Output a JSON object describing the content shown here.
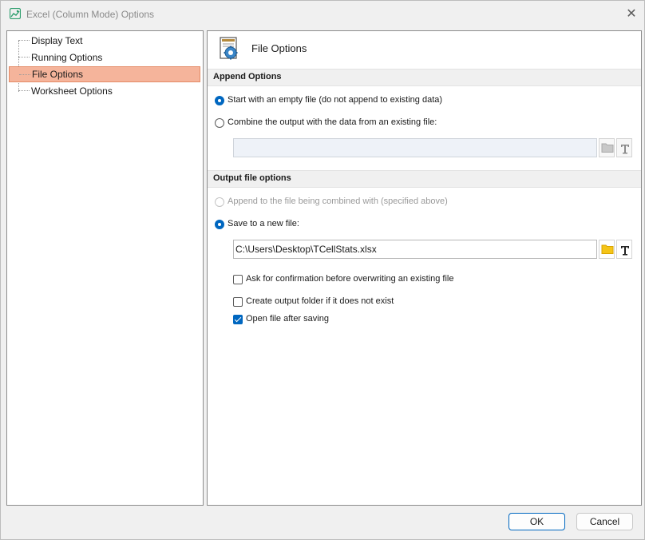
{
  "window": {
    "title": "Excel (Column Mode) Options",
    "close_glyph": "✕"
  },
  "tree": {
    "items": [
      {
        "label": "Display Text",
        "selected": false
      },
      {
        "label": "Running Options",
        "selected": false
      },
      {
        "label": "File Options",
        "selected": true
      },
      {
        "label": "Worksheet Options",
        "selected": false
      }
    ]
  },
  "content": {
    "title": "File Options",
    "append_section": {
      "heading": "Append Options",
      "option_empty": "Start with an empty file (do not append to existing data)",
      "option_combine": "Combine the output with the data from an existing file:",
      "combine_path": ""
    },
    "output_section": {
      "heading": "Output file options",
      "option_append_combined": "Append to the file being combined with (specified above)",
      "option_save_new": "Save to a new file:",
      "save_path": "C:\\Users\\Desktop\\TCellStats.xlsx",
      "check_confirm_overwrite": "Ask for confirmation before overwriting an existing file",
      "check_create_folder": "Create output folder if it does not exist",
      "check_open_after": "Open file after saving"
    }
  },
  "buttons": {
    "ok": "OK",
    "cancel": "Cancel"
  },
  "colors": {
    "selection": "#f5b49b",
    "accent": "#0067c0",
    "folder": "#f5c518"
  }
}
